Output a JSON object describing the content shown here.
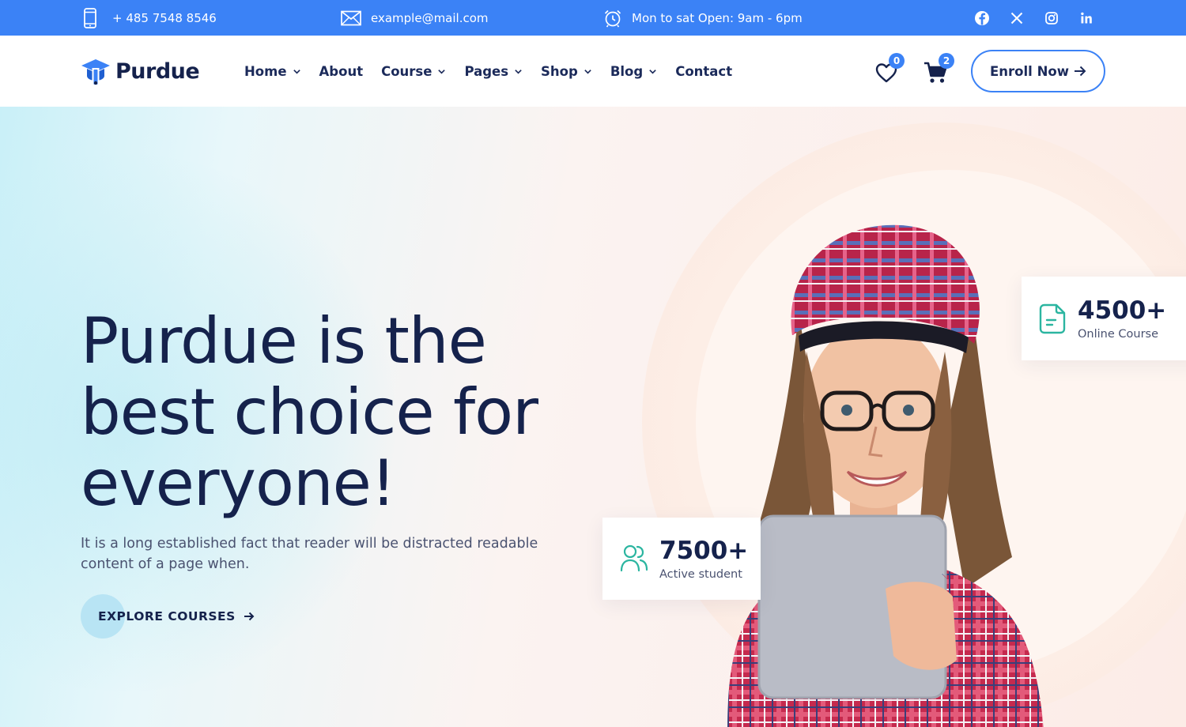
{
  "topbar": {
    "phone": "+ 485 7548 8546",
    "email": "example@mail.com",
    "hours": "Mon to sat Open: 9am - 6pm",
    "social": [
      "facebook-icon",
      "x-icon",
      "instagram-icon",
      "linkedin-icon"
    ]
  },
  "brand": {
    "name": "Purdue",
    "accent": "#3b82f6",
    "navy": "#15224c",
    "teal": "#2bb5a0"
  },
  "nav": {
    "items": [
      {
        "label": "Home",
        "dropdown": true
      },
      {
        "label": "About",
        "dropdown": false
      },
      {
        "label": "Course",
        "dropdown": true
      },
      {
        "label": "Pages",
        "dropdown": true
      },
      {
        "label": "Shop",
        "dropdown": true
      },
      {
        "label": "Blog",
        "dropdown": true
      },
      {
        "label": "Contact",
        "dropdown": false
      }
    ]
  },
  "header": {
    "wishlist_count": "0",
    "cart_count": "2",
    "enroll_label": "Enroll Now"
  },
  "hero": {
    "headline_line1": "Purdue is the",
    "headline_line2": "best choice for",
    "headline_line3": "everyone!",
    "lead_line1": "It is a long established fact that reader will be distracted readable",
    "lead_line2": "content of a page when.",
    "cta_label": "EXPLORE COURSES"
  },
  "stats": {
    "courses": {
      "value": "4500+",
      "caption": "Online Course"
    },
    "students": {
      "value": "7500+",
      "caption": "Active student"
    }
  }
}
